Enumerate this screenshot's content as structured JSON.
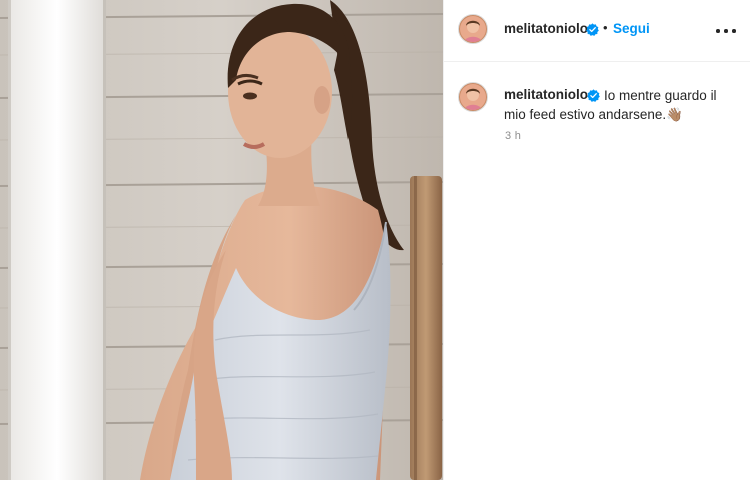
{
  "post": {
    "image_alt": "",
    "author": {
      "username": "melitatoniolo",
      "verified": true
    },
    "follow_label": "Segui",
    "separator": "•",
    "caption": "Io mentre guardo il mio feed estivo andarsene.",
    "caption_emoji": "👋🏽",
    "timestamp": "3 h"
  },
  "icons": {
    "verified": "verified-badge-icon",
    "more": "more-options-icon"
  },
  "colors": {
    "accent": "#0095f6",
    "verified": "#0095f6",
    "text": "#262626",
    "muted": "#8e8e8e",
    "divider": "#efefef"
  }
}
